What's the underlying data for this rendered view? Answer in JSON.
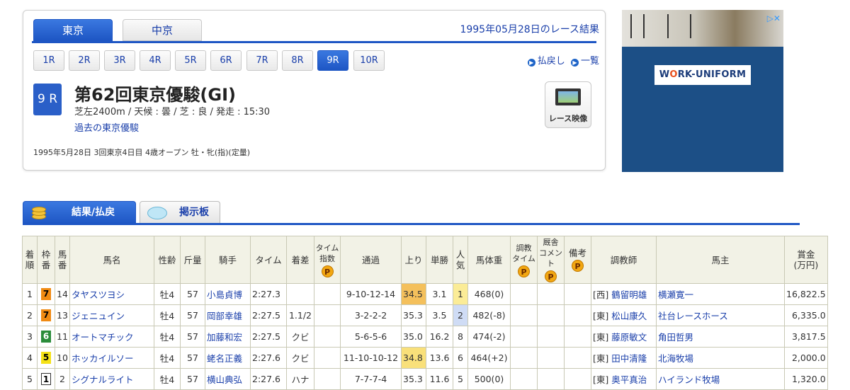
{
  "venue_tabs": [
    "東京",
    "中京"
  ],
  "race_date": "1995年05月28日のレース結果",
  "race_buttons": [
    "1R",
    "2R",
    "3R",
    "4R",
    "5R",
    "6R",
    "7R",
    "8R",
    "9R",
    "10R"
  ],
  "selected_race": "9R",
  "links": {
    "payout": "払戻し",
    "list": "一覧"
  },
  "race": {
    "number": "9 R",
    "title": "第62回東京優駿(GI)",
    "conditions": "芝左2400m / 天候 : 曇 / 芝 : 良 / 発走 : 15:30",
    "past_link": "過去の東京優駿",
    "class_info": "1995年5月28日 3回東京4日目 4歳オープン 牡・牝(指)(定量)",
    "video_label": "レース映像"
  },
  "ad": {
    "logo_main": "W",
    "logo_accent": "O",
    "logo_rest": "RK-UNIFORM",
    "choice": "▷✕"
  },
  "result_tabs": {
    "results": "結果/払戻",
    "board": "掲示板"
  },
  "table": {
    "headers": {
      "rank": [
        "着",
        "順"
      ],
      "waku": [
        "枠",
        "番"
      ],
      "num": [
        "馬",
        "番"
      ],
      "horse": "馬名",
      "sexage": "性齢",
      "weight": "斤量",
      "jockey": "騎手",
      "time": "タイム",
      "margin": "着差",
      "index": [
        "タイム",
        "指数"
      ],
      "passing": "通過",
      "agari": "上り",
      "odds": "単勝",
      "pop": [
        "人",
        "気"
      ],
      "bodyweight": "馬体重",
      "train": [
        "調教",
        "タイム"
      ],
      "comment": [
        "厩舎",
        "コメント"
      ],
      "remarks": "備考",
      "trainer": "調教師",
      "owner": "馬主",
      "prize": [
        "賞金",
        "(万円)"
      ],
      "p": "P"
    },
    "rows": [
      {
        "rank": "1",
        "waku": "7",
        "num": "14",
        "horse": "タヤスツヨシ",
        "sexage": "牡4",
        "weight": "57",
        "jockey": "小島貞博",
        "time": "2:27.3",
        "margin": "",
        "passing": "9-10-12-14",
        "agari": "34.5",
        "odds": "3.1",
        "pop": "1",
        "bodyweight": "468(0)",
        "region": "[西]",
        "trainer": "鶴留明雄",
        "owner": "横瀬寛一",
        "prize": "16,822.5"
      },
      {
        "rank": "2",
        "waku": "7",
        "num": "13",
        "horse": "ジェニュイン",
        "sexage": "牡4",
        "weight": "57",
        "jockey": "岡部幸雄",
        "time": "2:27.5",
        "margin": "1.1/2",
        "passing": "3-2-2-2",
        "agari": "35.3",
        "odds": "3.5",
        "pop": "2",
        "bodyweight": "482(-8)",
        "region": "[東]",
        "trainer": "松山康久",
        "owner": "社台レースホース",
        "prize": "6,335.0"
      },
      {
        "rank": "3",
        "waku": "6",
        "num": "11",
        "horse": "オートマチック",
        "sexage": "牡4",
        "weight": "57",
        "jockey": "加藤和宏",
        "time": "2:27.5",
        "margin": "クビ",
        "passing": "5-6-5-6",
        "agari": "35.0",
        "odds": "16.2",
        "pop": "8",
        "bodyweight": "474(-2)",
        "region": "[東]",
        "trainer": "藤原敏文",
        "owner": "角田哲男",
        "prize": "3,817.5"
      },
      {
        "rank": "4",
        "waku": "5",
        "num": "10",
        "horse": "ホッカイルソー",
        "sexage": "牡4",
        "weight": "57",
        "jockey": "蛯名正義",
        "time": "2:27.6",
        "margin": "クビ",
        "passing": "11-10-10-12",
        "agari": "34.8",
        "odds": "13.6",
        "pop": "6",
        "bodyweight": "464(+2)",
        "region": "[東]",
        "trainer": "田中清隆",
        "owner": "北海牧場",
        "prize": "2,000.0"
      },
      {
        "rank": "5",
        "waku": "1",
        "num": "2",
        "horse": "シグナルライト",
        "sexage": "牡4",
        "weight": "57",
        "jockey": "横山典弘",
        "time": "2:27.6",
        "margin": "ハナ",
        "passing": "7-7-7-4",
        "agari": "35.3",
        "odds": "11.6",
        "pop": "5",
        "bodyweight": "500(0)",
        "region": "[東]",
        "trainer": "奥平真治",
        "owner": "ハイランド牧場",
        "prize": "1,320.0"
      }
    ]
  },
  "colors": {
    "accent": "#1e56c4",
    "link": "#1a3faa",
    "header_bg": "#f2f2e6",
    "waku7": "#f08a12",
    "waku6": "#2b8c3a",
    "waku5": "#f5e216",
    "waku1": "#ffffff",
    "agari_fast": "#f4c05c",
    "agari_second": "#f9e07a",
    "pop1": "#fbec97",
    "pop2": "#cfdcf5"
  },
  "icons": {
    "bullet": "circle-play-icon",
    "video": "film-icon",
    "coins": "coins-icon",
    "bubble": "speech-bubble-icon",
    "premium": "p-badge-icon"
  }
}
